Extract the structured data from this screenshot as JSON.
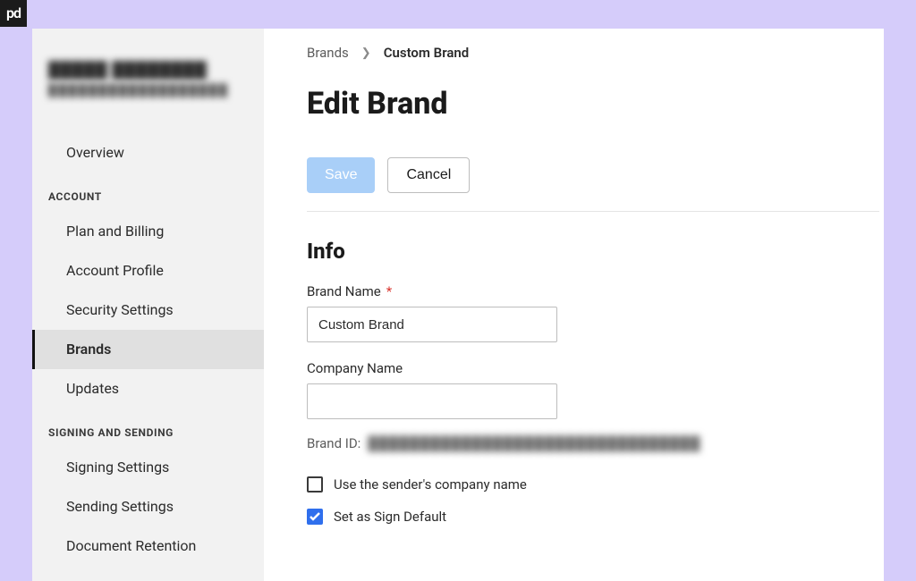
{
  "logo": {
    "text": "pd"
  },
  "sidebar": {
    "user_name": "█████ ████████",
    "user_sub": "██████████████████",
    "items_top": [
      {
        "label": "Overview"
      }
    ],
    "section_account": "ACCOUNT",
    "items_account": [
      {
        "label": "Plan and Billing"
      },
      {
        "label": "Account Profile"
      },
      {
        "label": "Security Settings"
      },
      {
        "label": "Brands",
        "active": true
      },
      {
        "label": "Updates"
      }
    ],
    "section_signing": "SIGNING AND SENDING",
    "items_signing": [
      {
        "label": "Signing Settings"
      },
      {
        "label": "Sending Settings"
      },
      {
        "label": "Document Retention"
      }
    ]
  },
  "breadcrumb": {
    "parent": "Brands",
    "current": "Custom Brand"
  },
  "page_title": "Edit Brand",
  "buttons": {
    "save": "Save",
    "cancel": "Cancel"
  },
  "info": {
    "heading": "Info",
    "brand_name_label": "Brand Name",
    "brand_name_value": "Custom Brand",
    "company_name_label": "Company Name",
    "company_name_value": "",
    "brand_id_label": "Brand ID:",
    "brand_id_value": "████████████████████████████████",
    "checkbox_sender": "Use the sender's company name",
    "checkbox_default": "Set as Sign Default",
    "checkbox_sender_checked": false,
    "checkbox_default_checked": true
  }
}
